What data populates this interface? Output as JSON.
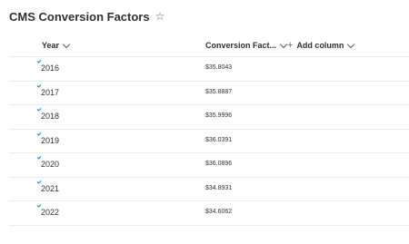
{
  "list": {
    "title": "CMS Conversion Factors",
    "favorite_icon": "star-outline-icon"
  },
  "columns": {
    "year": "Year",
    "factor": "Conversion Fact...",
    "add": "Add column"
  },
  "rows": [
    {
      "year": "2016",
      "factor": "$35.8043"
    },
    {
      "year": "2017",
      "factor": "$35.8887"
    },
    {
      "year": "2018",
      "factor": "$35.9996"
    },
    {
      "year": "2019",
      "factor": "$36.0391"
    },
    {
      "year": "2020",
      "factor": "$36.0896"
    },
    {
      "year": "2021",
      "factor": "$34.8931"
    },
    {
      "year": "2022",
      "factor": "$34.6062"
    }
  ],
  "colors": {
    "accent": "#0078d4",
    "divider": "#edebe9",
    "text": "#323130"
  }
}
